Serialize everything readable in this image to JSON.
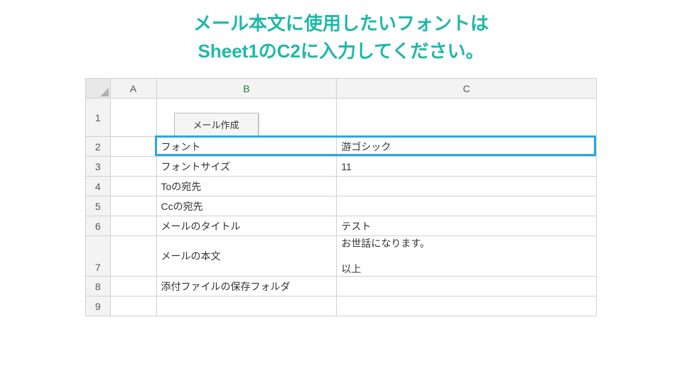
{
  "heading": {
    "line1": "メール本文に使用したいフォントは",
    "line2": "Sheet1のC2に入力してください。"
  },
  "columns": {
    "a": "A",
    "b": "B",
    "c": "C"
  },
  "rows": {
    "r1": "1",
    "r2": "2",
    "r3": "3",
    "r4": "4",
    "r5": "5",
    "r6": "6",
    "r7": "7",
    "r8": "8",
    "r9": "9"
  },
  "button": {
    "mail_create": "メール作成"
  },
  "cells": {
    "r2": {
      "b": "フォント",
      "c": "游ゴシック"
    },
    "r3": {
      "b": "フォントサイズ",
      "c": "11"
    },
    "r4": {
      "b": "Toの宛先",
      "c": ""
    },
    "r5": {
      "b": "Ccの宛先",
      "c": ""
    },
    "r6": {
      "b": "メールのタイトル",
      "c": "テスト"
    },
    "r7": {
      "b": "メールの本文",
      "c": "お世話になります。\n\n以上"
    },
    "r8": {
      "b": "添付ファイルの保存フォルダ",
      "c": ""
    },
    "r9": {
      "b": "",
      "c": ""
    }
  }
}
